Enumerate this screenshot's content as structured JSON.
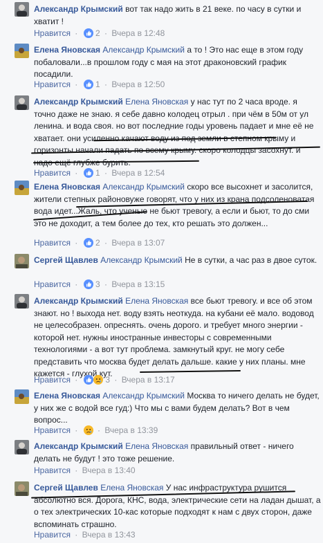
{
  "comments": [
    {
      "author": "Александр Крымский",
      "mention": "",
      "text": "вот так надо жить в 21 веке. по часу в сутки и хватит !",
      "like_label": "Нравится",
      "reaction": "like",
      "reaction_count": "2",
      "time": "Вчера в 12:48"
    },
    {
      "author": "Елена Яновская",
      "mention": "Александр Крымский",
      "text": "а то ! Это нас еще в этом году побаловали...в прошлом году с мая на этот драконовский график посадили.",
      "like_label": "Нравится",
      "reaction": "like",
      "reaction_count": "1",
      "time": "Вчера в 12:50"
    },
    {
      "author": "Александр Крымский",
      "mention": "Елена Яновская",
      "text": "у нас тут по 2 часа вроде. я точно даже не знаю. я себе давно колодец отрыл . при чём в 50м от ул ленина. и вода своя. но вот последние годы уровень падает и мне её не хватает. они усиленно качают воду из под земли в степном крыму и горизонты начали падать по всему крыму. скоро колодцы засохнут. и надо ещё глубже бурить.",
      "like_label": "Нравится",
      "reaction": "like",
      "reaction_count": "1",
      "time": "Вчера в 12:54"
    },
    {
      "author": "Елена Яновская",
      "mention": "Александр Крымский",
      "text": "скоро все высохнет и засолится, жители степных районовуже говорят, что у них из крана подсоленоватая вода идет...Жаль, что ученые не бьют тревогу, а если и бьют, то до сми это не доходит, а тем более до тех, кто решать это должен...",
      "like_label": "Нравится",
      "reaction": "like",
      "reaction_count": "2",
      "time": "Вчера в 13:07"
    },
    {
      "author": "Сергей Щавлев",
      "mention": "Александр Крымский",
      "text": "Не в сутки, а час раз в двое суток.",
      "like_label": "Нравится",
      "reaction": "like",
      "reaction_count": "3",
      "time": "Вчера в 13:15"
    },
    {
      "author": "Александр Крымский",
      "mention": "Елена Яновская",
      "text": "все бьют тревогу. и все об этом знают. но ! выхода нет. воду взять неоткуда. на кубани её мало. водовод не целесобразен. опреснять. очень дорого. и требует много энергии - которой нет. нужны иностранные инвесторы с современными технологиями - а вот тут проблема. замкнутый круг. не могу себе представить что москва будет делать дальше. какие у них планы. мне кажется - глухой кут.",
      "like_label": "Нравится",
      "reaction": "like-sad",
      "reaction_count": "3",
      "time": "Вчера в 13:17"
    },
    {
      "author": "Елена Яновская",
      "mention": "Александр Крымский",
      "text": "Москва то ничего делать не будет, у них же с водой все гуд:) Что мы с вами будем делать? Вот в чем вопрос...",
      "like_label": "Нравится",
      "reaction": "sad",
      "reaction_count": "",
      "time": "Вчера в 13:39"
    },
    {
      "author": "Александр Крымский",
      "mention": "Елена Яновская",
      "text": "правильный ответ - ничего делать не будут ! это тоже решение.",
      "like_label": "Нравится",
      "reaction": "none",
      "reaction_count": "",
      "time": "Вчера в 13:40"
    },
    {
      "author": "Сергей Щавлев",
      "mention": "Елена Яновская",
      "text": "У нас инфраструктура рушится абсолютно вся. Дорога, КНС, вода, электрические сети на ладан дышат, а о тех электрических 10-кас которые подходят к нам с двух сторон, даже вспоминать страшно.",
      "like_label": "Нравится",
      "reaction": "none",
      "reaction_count": "",
      "time": "Вчера в 13:43"
    }
  ],
  "colors": {
    "author": "#365899",
    "meta": "#90949c",
    "like_blue": "#5890ff",
    "sad_yellow": "#f7b928",
    "underline": "#111111"
  }
}
